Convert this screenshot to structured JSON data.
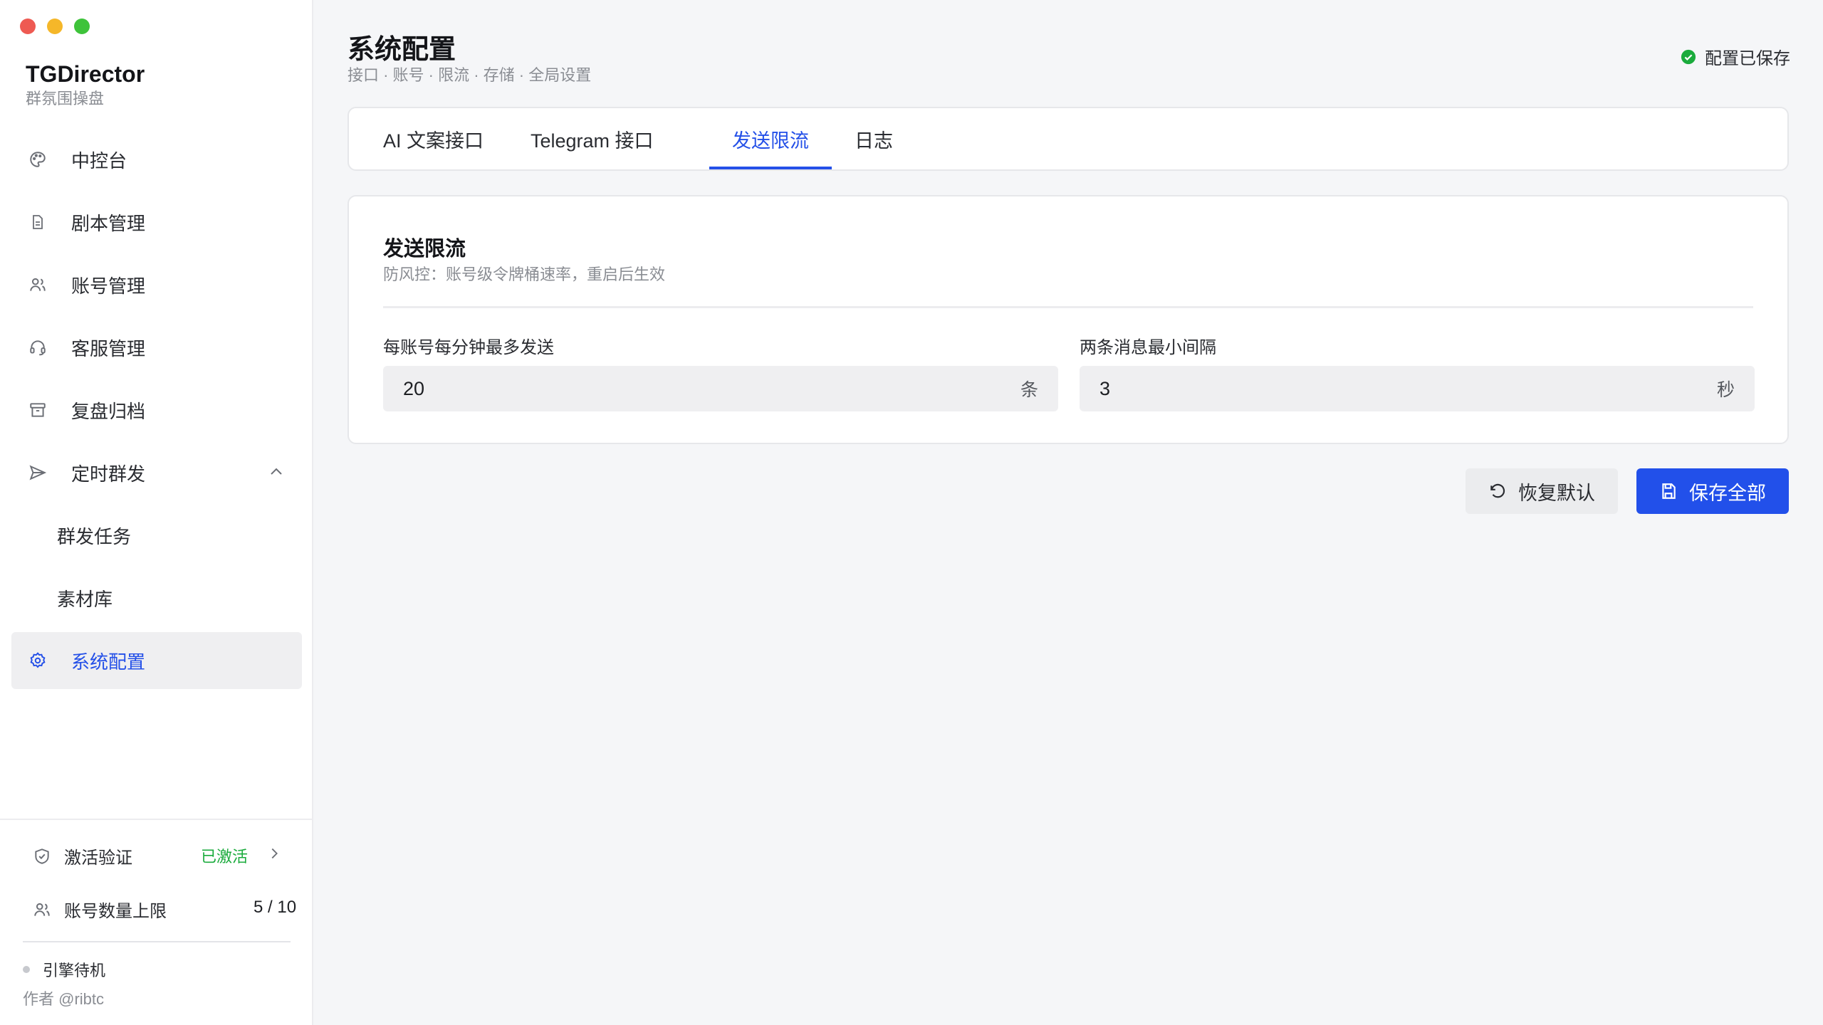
{
  "app": {
    "name": "TGDirector",
    "subtitle": "群氛围操盘"
  },
  "sidebar": {
    "items": [
      {
        "label": "中控台",
        "icon": "palette-icon"
      },
      {
        "label": "剧本管理",
        "icon": "document-icon"
      },
      {
        "label": "账号管理",
        "icon": "users-icon"
      },
      {
        "label": "客服管理",
        "icon": "headset-icon"
      },
      {
        "label": "复盘归档",
        "icon": "archive-icon"
      },
      {
        "label": "定时群发",
        "icon": "send-icon",
        "expanded": true
      },
      {
        "label": "群发任务"
      },
      {
        "label": "素材库"
      },
      {
        "label": "系统配置",
        "icon": "gear-icon",
        "active": true
      }
    ],
    "activation": {
      "label": "激活验证",
      "status": "已激活"
    },
    "accounts": {
      "label": "账号数量上限",
      "value": "5 / 10"
    },
    "engine_status": "引擎待机",
    "author": "作者 @ribtc"
  },
  "header": {
    "title": "系统配置",
    "subtitle": "接口 · 账号 · 限流 · 存储 · 全局设置",
    "saved_status": "配置已保存"
  },
  "tabs": [
    {
      "label": "AI 文案接口"
    },
    {
      "label": "Telegram 接口"
    },
    {
      "label": "发送限流",
      "active": true
    },
    {
      "label": "日志"
    }
  ],
  "card": {
    "title": "发送限流",
    "subtitle": "防风控：账号级令牌桶速率，重启后生效",
    "fields": [
      {
        "label": "每账号每分钟最多发送",
        "value": "20",
        "unit": "条"
      },
      {
        "label": "两条消息最小间隔",
        "value": "3",
        "unit": "秒"
      }
    ]
  },
  "actions": {
    "reset_label": "恢复默认",
    "save_label": "保存全部"
  },
  "colors": {
    "accent": "#2450e8",
    "success": "#1aab3c",
    "active_nav_bg": "#efeff1"
  }
}
